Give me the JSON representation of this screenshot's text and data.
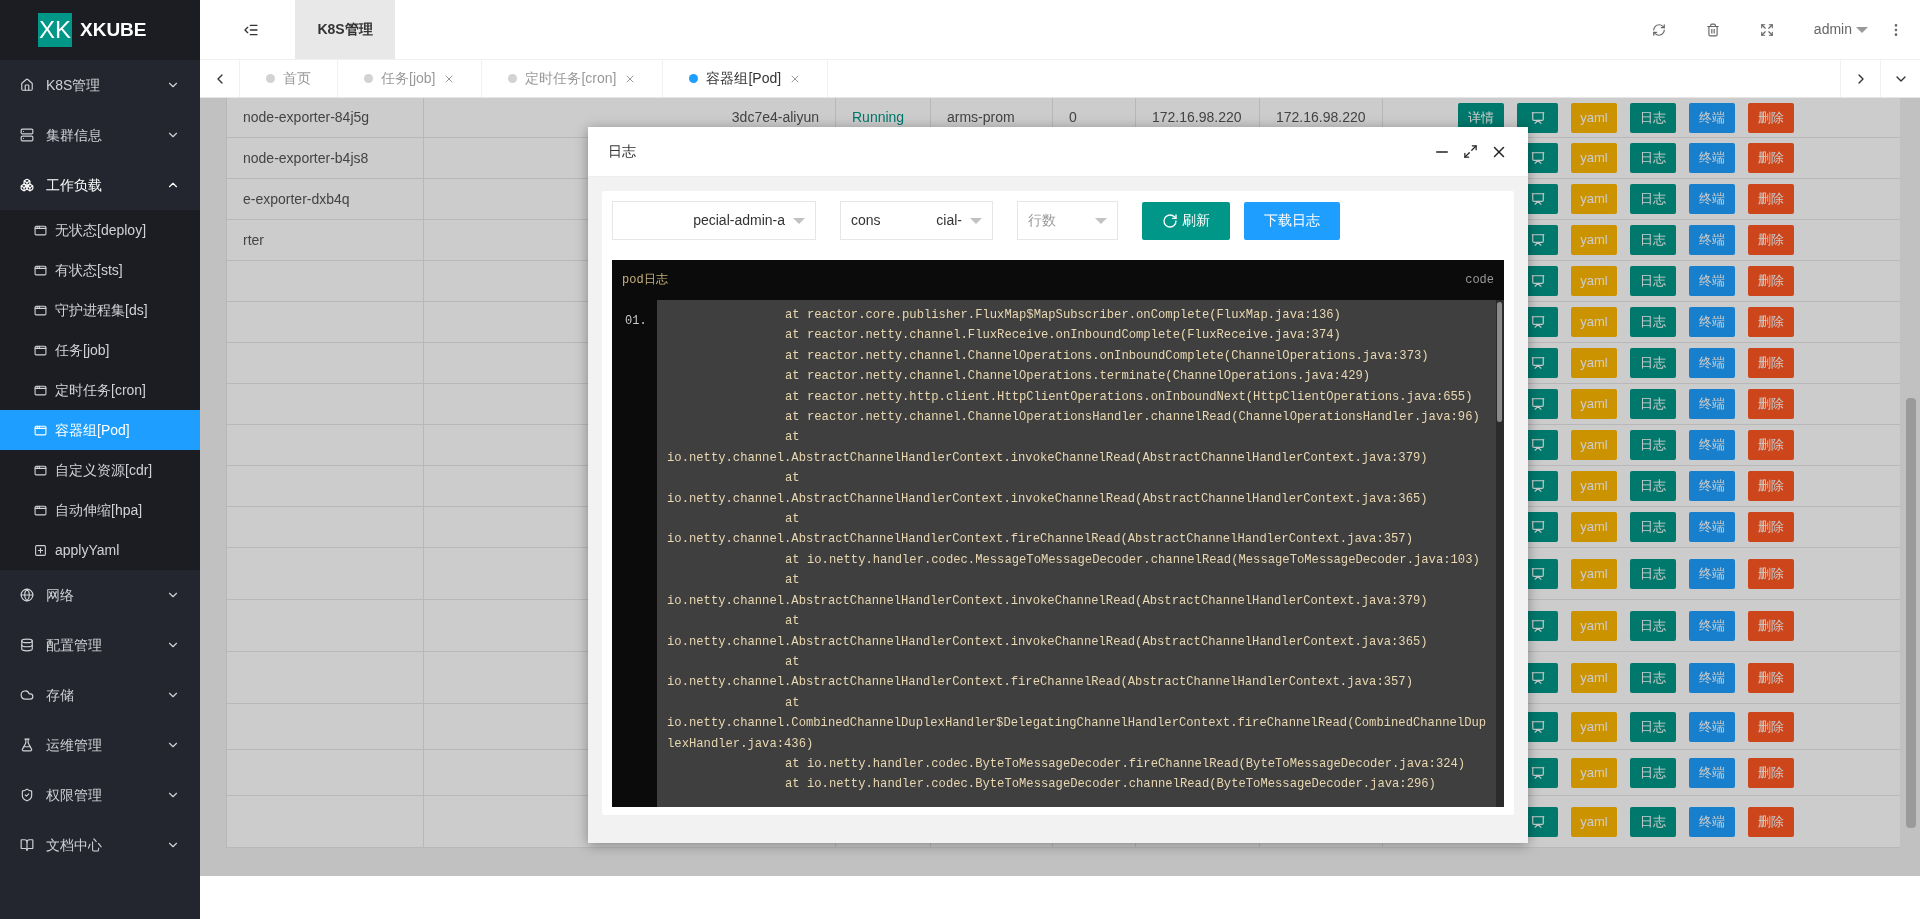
{
  "sidebar": {
    "logo": "XK",
    "brand": "XKUBE",
    "items": [
      {
        "label": "K8S管理",
        "expanded": false
      },
      {
        "label": "集群信息",
        "expanded": false
      },
      {
        "label": "工作负载",
        "expanded": true,
        "children": [
          {
            "label": "无状态[deploy]",
            "selected": false
          },
          {
            "label": "有状态[sts]",
            "selected": false
          },
          {
            "label": "守护进程集[ds]",
            "selected": false
          },
          {
            "label": "任务[job]",
            "selected": false
          },
          {
            "label": "定时任务[cron]",
            "selected": false
          },
          {
            "label": "容器组[Pod]",
            "selected": true
          },
          {
            "label": "自定义资源[cdr]",
            "selected": false
          },
          {
            "label": "自动伸缩[hpa]",
            "selected": false
          },
          {
            "label": "applyYaml",
            "selected": false
          }
        ]
      },
      {
        "label": "网络",
        "expanded": false
      },
      {
        "label": "配置管理",
        "expanded": false
      },
      {
        "label": "存储",
        "expanded": false
      },
      {
        "label": "运维管理",
        "expanded": false
      },
      {
        "label": "权限管理",
        "expanded": false
      },
      {
        "label": "文档中心",
        "expanded": false
      }
    ]
  },
  "header": {
    "breadcrumb": "K8S管理",
    "user": "admin"
  },
  "tabs": [
    {
      "label": "首页",
      "selected": false,
      "closable": false
    },
    {
      "label": "任务[job]",
      "selected": false,
      "closable": true
    },
    {
      "label": "定时任务[cron]",
      "selected": false,
      "closable": true
    },
    {
      "label": "容器组[Pod]",
      "selected": true,
      "closable": true
    }
  ],
  "table": {
    "rows": [
      {
        "name": "node-exporter-84j5g",
        "image": "3dc7e4-aliyun",
        "status": "Running",
        "namespace": "arms-prom",
        "restarts": "0",
        "pod_ip": "172.16.98.220",
        "host_ip": "172.16.98.220",
        "actions": [
          {
            "kind": "detail",
            "label": "详情"
          },
          {
            "kind": "monitor"
          },
          {
            "kind": "yaml",
            "label": "yaml"
          },
          {
            "kind": "log",
            "label": "日志"
          },
          {
            "kind": "terminal",
            "label": "终端"
          },
          {
            "kind": "delete",
            "label": "删除"
          }
        ]
      },
      {
        "name": "node-exporter-b4js8",
        "actions": [
          {
            "kind": "monitor"
          },
          {
            "kind": "yaml",
            "label": "yaml"
          },
          {
            "kind": "log",
            "label": "日志"
          },
          {
            "kind": "terminal",
            "label": "终端"
          },
          {
            "kind": "delete",
            "label": "删除"
          }
        ]
      },
      {
        "name": "e-exporter-dxb4q",
        "actions": [
          {
            "kind": "monitor"
          },
          {
            "kind": "yaml",
            "label": "yaml"
          },
          {
            "kind": "log",
            "label": "日志"
          },
          {
            "kind": "terminal",
            "label": "终端"
          },
          {
            "kind": "delete",
            "label": "删除"
          }
        ]
      },
      {
        "name": "rter",
        "actions": [
          {
            "kind": "monitor"
          },
          {
            "kind": "yaml",
            "label": "yaml"
          },
          {
            "kind": "log",
            "label": "日志"
          },
          {
            "kind": "terminal",
            "label": "终端"
          },
          {
            "kind": "delete",
            "label": "删除"
          }
        ]
      },
      {
        "actions": [
          {
            "kind": "monitor"
          },
          {
            "kind": "yaml",
            "label": "yaml"
          },
          {
            "kind": "log",
            "label": "日志"
          },
          {
            "kind": "terminal",
            "label": "终端"
          },
          {
            "kind": "delete",
            "label": "删除"
          }
        ]
      },
      {
        "actions": [
          {
            "kind": "monitor"
          },
          {
            "kind": "yaml",
            "label": "yaml"
          },
          {
            "kind": "log",
            "label": "日志"
          },
          {
            "kind": "terminal",
            "label": "终端"
          },
          {
            "kind": "delete",
            "label": "删除"
          }
        ]
      },
      {
        "actions": [
          {
            "kind": "monitor"
          },
          {
            "kind": "yaml",
            "label": "yaml"
          },
          {
            "kind": "log",
            "label": "日志"
          },
          {
            "kind": "terminal",
            "label": "终端"
          },
          {
            "kind": "delete",
            "label": "删除"
          }
        ]
      },
      {
        "actions": [
          {
            "kind": "monitor"
          },
          {
            "kind": "yaml",
            "label": "yaml"
          },
          {
            "kind": "log",
            "label": "日志"
          },
          {
            "kind": "terminal",
            "label": "终端"
          },
          {
            "kind": "delete",
            "label": "删除"
          }
        ]
      },
      {
        "actions": [
          {
            "kind": "monitor"
          },
          {
            "kind": "yaml",
            "label": "yaml"
          },
          {
            "kind": "log",
            "label": "日志"
          },
          {
            "kind": "terminal",
            "label": "终端"
          },
          {
            "kind": "delete",
            "label": "删除"
          }
        ]
      },
      {
        "actions": [
          {
            "kind": "monitor"
          },
          {
            "kind": "yaml",
            "label": "yaml"
          },
          {
            "kind": "log",
            "label": "日志"
          },
          {
            "kind": "terminal",
            "label": "终端"
          },
          {
            "kind": "delete",
            "label": "删除"
          }
        ]
      },
      {
        "actions": [
          {
            "kind": "monitor"
          },
          {
            "kind": "yaml",
            "label": "yaml"
          },
          {
            "kind": "log",
            "label": "日志"
          },
          {
            "kind": "terminal",
            "label": "终端"
          },
          {
            "kind": "delete",
            "label": "删除"
          }
        ]
      },
      {
        "actions": [
          {
            "kind": "monitor"
          },
          {
            "kind": "yaml",
            "label": "yaml"
          },
          {
            "kind": "log",
            "label": "日志"
          },
          {
            "kind": "terminal",
            "label": "终端"
          },
          {
            "kind": "delete",
            "label": "删除"
          }
        ]
      },
      {
        "actions": [
          {
            "kind": "monitor"
          },
          {
            "kind": "yaml",
            "label": "yaml"
          },
          {
            "kind": "log",
            "label": "日志"
          },
          {
            "kind": "terminal",
            "label": "终端"
          },
          {
            "kind": "delete",
            "label": "删除"
          }
        ]
      },
      {
        "actions": [
          {
            "kind": "monitor"
          },
          {
            "kind": "yaml",
            "label": "yaml"
          },
          {
            "kind": "log",
            "label": "日志"
          },
          {
            "kind": "terminal",
            "label": "终端"
          },
          {
            "kind": "delete",
            "label": "删除"
          }
        ]
      },
      {
        "actions": [
          {
            "kind": "monitor"
          },
          {
            "kind": "yaml",
            "label": "yaml"
          },
          {
            "kind": "log",
            "label": "日志"
          },
          {
            "kind": "terminal",
            "label": "终端"
          },
          {
            "kind": "delete",
            "label": "删除"
          }
        ]
      },
      {
        "actions": [
          {
            "kind": "monitor"
          },
          {
            "kind": "yaml",
            "label": "yaml"
          },
          {
            "kind": "log",
            "label": "日志"
          },
          {
            "kind": "terminal",
            "label": "终端"
          },
          {
            "kind": "delete",
            "label": "删除"
          }
        ]
      },
      {
        "actions": [
          {
            "kind": "monitor"
          },
          {
            "kind": "yaml",
            "label": "yaml"
          },
          {
            "kind": "log",
            "label": "日志"
          },
          {
            "kind": "terminal",
            "label": "终端"
          },
          {
            "kind": "delete",
            "label": "删除"
          }
        ]
      }
    ]
  },
  "modal": {
    "title": "日志",
    "selects": [
      {
        "kind": "value",
        "value": "pecial-admin-a"
      },
      {
        "kind": "split",
        "value_parts": [
          "cons",
          "cial-"
        ]
      },
      {
        "kind": "placeholder",
        "placeholder": "行数"
      }
    ],
    "buttons": [
      {
        "kind": "refresh",
        "label": "刷新"
      },
      {
        "kind": "download",
        "label": "下载日志"
      }
    ],
    "log": {
      "title": "pod日志",
      "language": "code",
      "line_number": "01.",
      "lines": [
        {
          "kind": "indented",
          "text": "at reactor.core.publisher.FluxMap$MapSubscriber.onComplete(FluxMap.java:136)"
        },
        {
          "kind": "indented",
          "text": "at reactor.netty.channel.FluxReceive.onInboundComplete(FluxReceive.java:374)"
        },
        {
          "kind": "indented",
          "text": "at reactor.netty.channel.ChannelOperations.onInboundComplete(ChannelOperations.java:373)"
        },
        {
          "kind": "indented",
          "text": "at reactor.netty.channel.ChannelOperations.terminate(ChannelOperations.java:429)"
        },
        {
          "kind": "indented",
          "text": "at reactor.netty.http.client.HttpClientOperations.onInboundNext(HttpClientOperations.java:655)"
        },
        {
          "kind": "indented",
          "text": "at reactor.netty.channel.ChannelOperationsHandler.channelRead(ChannelOperationsHandler.java:96)"
        },
        {
          "kind": "indented",
          "text": "at"
        },
        {
          "kind": "plain",
          "text": "io.netty.channel.AbstractChannelHandlerContext.invokeChannelRead(AbstractChannelHandlerContext.java:379)"
        },
        {
          "kind": "indented",
          "text": "at"
        },
        {
          "kind": "plain",
          "text": "io.netty.channel.AbstractChannelHandlerContext.invokeChannelRead(AbstractChannelHandlerContext.java:365)"
        },
        {
          "kind": "indented",
          "text": "at"
        },
        {
          "kind": "plain",
          "text": "io.netty.channel.AbstractChannelHandlerContext.fireChannelRead(AbstractChannelHandlerContext.java:357)"
        },
        {
          "kind": "indented",
          "text": "at io.netty.handler.codec.MessageToMessageDecoder.channelRead(MessageToMessageDecoder.java:103)"
        },
        {
          "kind": "indented",
          "text": "at"
        },
        {
          "kind": "plain",
          "text": "io.netty.channel.AbstractChannelHandlerContext.invokeChannelRead(AbstractChannelHandlerContext.java:379)"
        },
        {
          "kind": "indented",
          "text": "at"
        },
        {
          "kind": "plain",
          "text": "io.netty.channel.AbstractChannelHandlerContext.invokeChannelRead(AbstractChannelHandlerContext.java:365)"
        },
        {
          "kind": "indented",
          "text": "at"
        },
        {
          "kind": "plain",
          "text": "io.netty.channel.AbstractChannelHandlerContext.fireChannelRead(AbstractChannelHandlerContext.java:357)"
        },
        {
          "kind": "indented",
          "text": "at"
        },
        {
          "kind": "plain",
          "text": "io.netty.channel.CombinedChannelDuplexHandler$DelegatingChannelHandlerContext.fireChannelRead(CombinedChannelDuplexHandler.java:436)"
        },
        {
          "kind": "indented",
          "text": "at io.netty.handler.codec.ByteToMessageDecoder.fireChannelRead(ByteToMessageDecoder.java:324)"
        },
        {
          "kind": "indented",
          "text": "at io.netty.handler.codec.ByteToMessageDecoder.channelRead(ByteToMessageDecoder.java:296)"
        }
      ]
    }
  }
}
